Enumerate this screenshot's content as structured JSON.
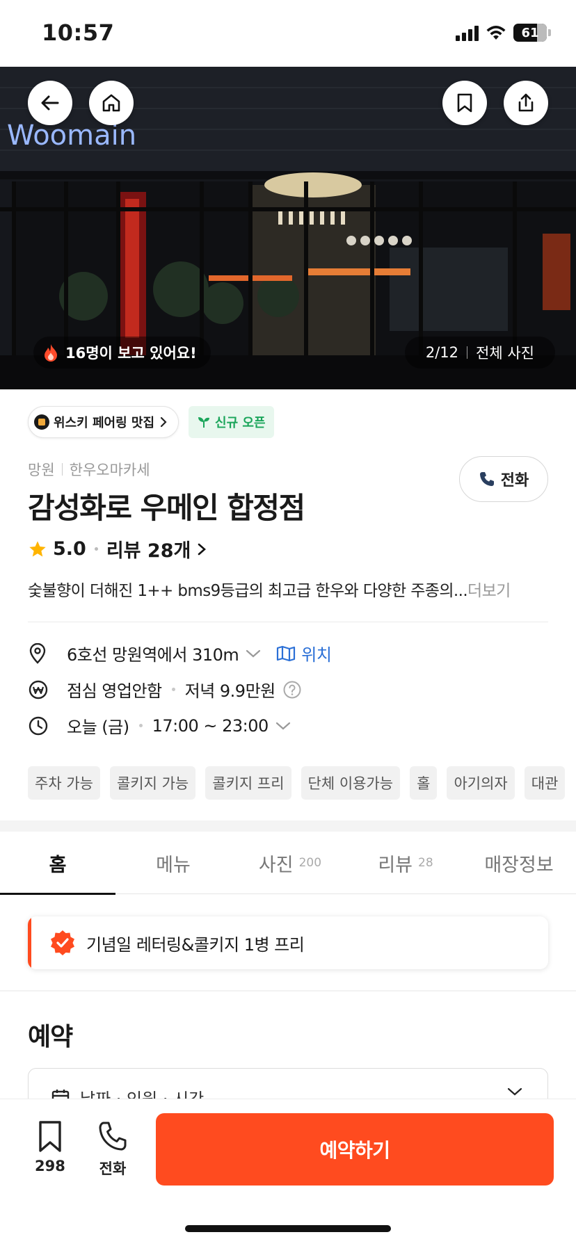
{
  "status_bar": {
    "time": "10:57",
    "battery": "61"
  },
  "hero": {
    "sign_text": "Woomain",
    "viewers_text": "16명이 보고 있어요!",
    "photo_index": "2/12",
    "all_photos_label": "전체 사진"
  },
  "badges": {
    "whisky": "위스키 페어링 맛집",
    "new_open": "신규 오픈"
  },
  "store": {
    "area": "망원",
    "category": "한우오마카세",
    "name": "감성화로 우메인 합정점",
    "call_label": "전화",
    "rating": "5.0",
    "reviews_label": "리뷰 28개",
    "description": "숯불향이 더해진  1++ bms9등급의 최고급 한우와 다양한 주종의...",
    "more_label": "더보기"
  },
  "info": {
    "distance": "6호선 망원역에서 310m",
    "location_label": "위치",
    "lunch": "점심 영업안함",
    "dinner": "저녁 9.9만원",
    "today": "오늘 (금)",
    "hours": "17:00 ~ 23:00"
  },
  "tags": [
    "주차 가능",
    "콜키지 가능",
    "콜키지 프리",
    "단체 이용가능",
    "홀",
    "아기의자",
    "대관"
  ],
  "tabs": [
    {
      "label": "홈",
      "count": ""
    },
    {
      "label": "메뉴",
      "count": ""
    },
    {
      "label": "사진",
      "count": "200"
    },
    {
      "label": "리뷰",
      "count": "28"
    },
    {
      "label": "매장정보",
      "count": ""
    }
  ],
  "promo": {
    "text": "기념일 레터링&콜키지 1병 프리"
  },
  "reservation": {
    "title": "예약",
    "selector_placeholder": "날짜 · 인원 · 시간"
  },
  "bottom_bar": {
    "bookmark_count": "298",
    "call_label": "전화",
    "reserve_label": "예약하기"
  },
  "colors": {
    "accent": "#ff4b1f",
    "link": "#2a6fd6",
    "new_badge": "#1aa55a",
    "star": "#ffb400"
  },
  "icons": [
    "back-arrow-icon",
    "home-icon",
    "bookmark-icon",
    "share-icon",
    "fire-icon",
    "phone-icon",
    "star-icon",
    "pin-icon",
    "won-icon",
    "clock-icon",
    "map-icon",
    "help-icon",
    "calendar-icon",
    "verified-icon"
  ]
}
